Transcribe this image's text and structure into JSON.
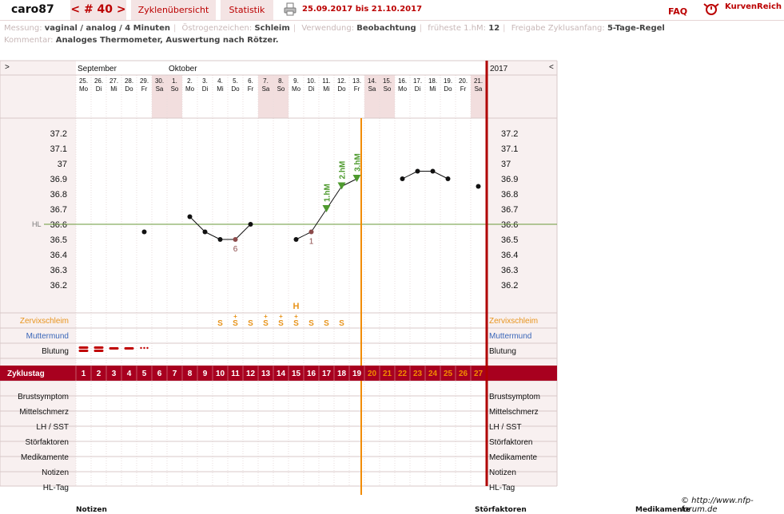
{
  "header": {
    "user": "caro87",
    "cycle_nav": "< # 40 >",
    "overview": "Zyklenübersicht",
    "stats": "Statistik",
    "date_range": "25.09.2017 bis 21.10.2017",
    "faq": "FAQ",
    "brand": "KurvenReich"
  },
  "meta": {
    "messung_label": "Messung:",
    "messung": "vaginal / analog / 4 Minuten",
    "oestrogen_label": "Östrogenzeichen:",
    "oestrogen": "Schleim",
    "verwendung_label": "Verwendung:",
    "verwendung": "Beobachtung",
    "frueheste_label": "früheste 1.hM:",
    "frueheste": "12",
    "freigabe_label": "Freigabe Zyklusanfang:",
    "freigabe": "5-Tage-Regel",
    "kommentar_label": "Kommentar:",
    "kommentar": "Analoges Thermometer, Auswertung nach Rötzer."
  },
  "chart_data": {
    "type": "line",
    "title": "",
    "year": "2017",
    "nav_left": ">",
    "nav_right": "<",
    "months": [
      {
        "label": "September",
        "start_index": 0
      },
      {
        "label": "Oktober",
        "start_index": 6
      }
    ],
    "dates": [
      "25.",
      "26.",
      "27.",
      "28.",
      "29.",
      "30.",
      "1.",
      "2.",
      "3.",
      "4.",
      "5.",
      "6.",
      "7.",
      "8.",
      "9.",
      "10.",
      "11.",
      "12.",
      "13.",
      "14.",
      "15.",
      "16.",
      "17.",
      "18.",
      "19.",
      "20.",
      "21."
    ],
    "weekdays": [
      "Mo",
      "Di",
      "Mi",
      "Do",
      "Fr",
      "Sa",
      "So",
      "Mo",
      "Di",
      "Mi",
      "Do",
      "Fr",
      "Sa",
      "So",
      "Mo",
      "Di",
      "Mi",
      "Do",
      "Fr",
      "Sa",
      "So",
      "Mo",
      "Di",
      "Mi",
      "Do",
      "Fr",
      "Sa"
    ],
    "cycle_days": [
      "1",
      "2",
      "3",
      "4",
      "5",
      "6",
      "7",
      "8",
      "9",
      "10",
      "11",
      "12",
      "13",
      "14",
      "15",
      "16",
      "17",
      "18",
      "19",
      "20",
      "21",
      "22",
      "23",
      "24",
      "25",
      "26",
      "27"
    ],
    "temperatures": [
      null,
      null,
      null,
      null,
      36.55,
      null,
      null,
      36.65,
      36.55,
      36.5,
      36.5,
      36.6,
      null,
      null,
      36.5,
      36.55,
      36.7,
      36.85,
      36.9,
      null,
      null,
      36.9,
      36.95,
      36.95,
      36.9,
      null,
      36.85
    ],
    "excluded_days": [
      11,
      16
    ],
    "marker_days": [
      {
        "day": 17,
        "label": "1.hM"
      },
      {
        "day": 18,
        "label": "2.hM"
      },
      {
        "day": 19,
        "label": "3.hM"
      }
    ],
    "low_point_labels": [
      {
        "day": 11,
        "label": "6"
      },
      {
        "day": 16,
        "label": "1"
      }
    ],
    "y_ticks": [
      "37.2",
      "37.1",
      "37",
      "36.9",
      "36.8",
      "36.7",
      "36.6",
      "36.5",
      "36.4",
      "36.3",
      "36.2"
    ],
    "ylim": [
      36.1,
      37.3
    ],
    "coverline": 36.6,
    "coverline_label": "HL",
    "evaluation_after_day": 19,
    "rows_top": {
      "labels": [
        "Zervixschleim",
        "Muttermund",
        "Blutung"
      ],
      "label_colors": [
        "#e8941c",
        "#3a66b8",
        "#111111"
      ],
      "mucus": [
        null,
        null,
        null,
        null,
        null,
        null,
        null,
        null,
        null,
        "S",
        "S+",
        "S",
        "S+",
        "S+",
        "S+",
        "S",
        "S",
        "S",
        null,
        null,
        null,
        null,
        null,
        null,
        null,
        null,
        null
      ],
      "peak_day": 15,
      "peak_label": "H",
      "bleeding": [
        "heavy",
        "heavy",
        "medium",
        "medium",
        "light",
        null,
        null,
        null,
        null,
        null,
        null,
        null,
        null,
        null,
        null,
        null,
        null,
        null,
        null,
        null,
        null,
        null,
        null,
        null,
        null,
        null,
        null
      ]
    },
    "cycle_row_label": "Zyklustag",
    "rows_bottom": [
      "Brustsymptom",
      "Mittelschmerz",
      "LH / SST",
      "Störfaktoren",
      "Medikamente",
      "Notizen",
      "HL-Tag"
    ]
  },
  "footer": {
    "copyright": "© http://www.nfp-forum.de",
    "col1": "Notizen",
    "col2": "Störfaktoren",
    "col3": "Medikamente"
  },
  "colors": {
    "accent": "#b00000",
    "cycle_bar": "#a8001f",
    "weekend": "#f2dede",
    "evaluation_line": "#f28c00",
    "coverline": "#6a9a3a",
    "marker": "#4e9a2e",
    "excluded": "#8b4a4a"
  }
}
